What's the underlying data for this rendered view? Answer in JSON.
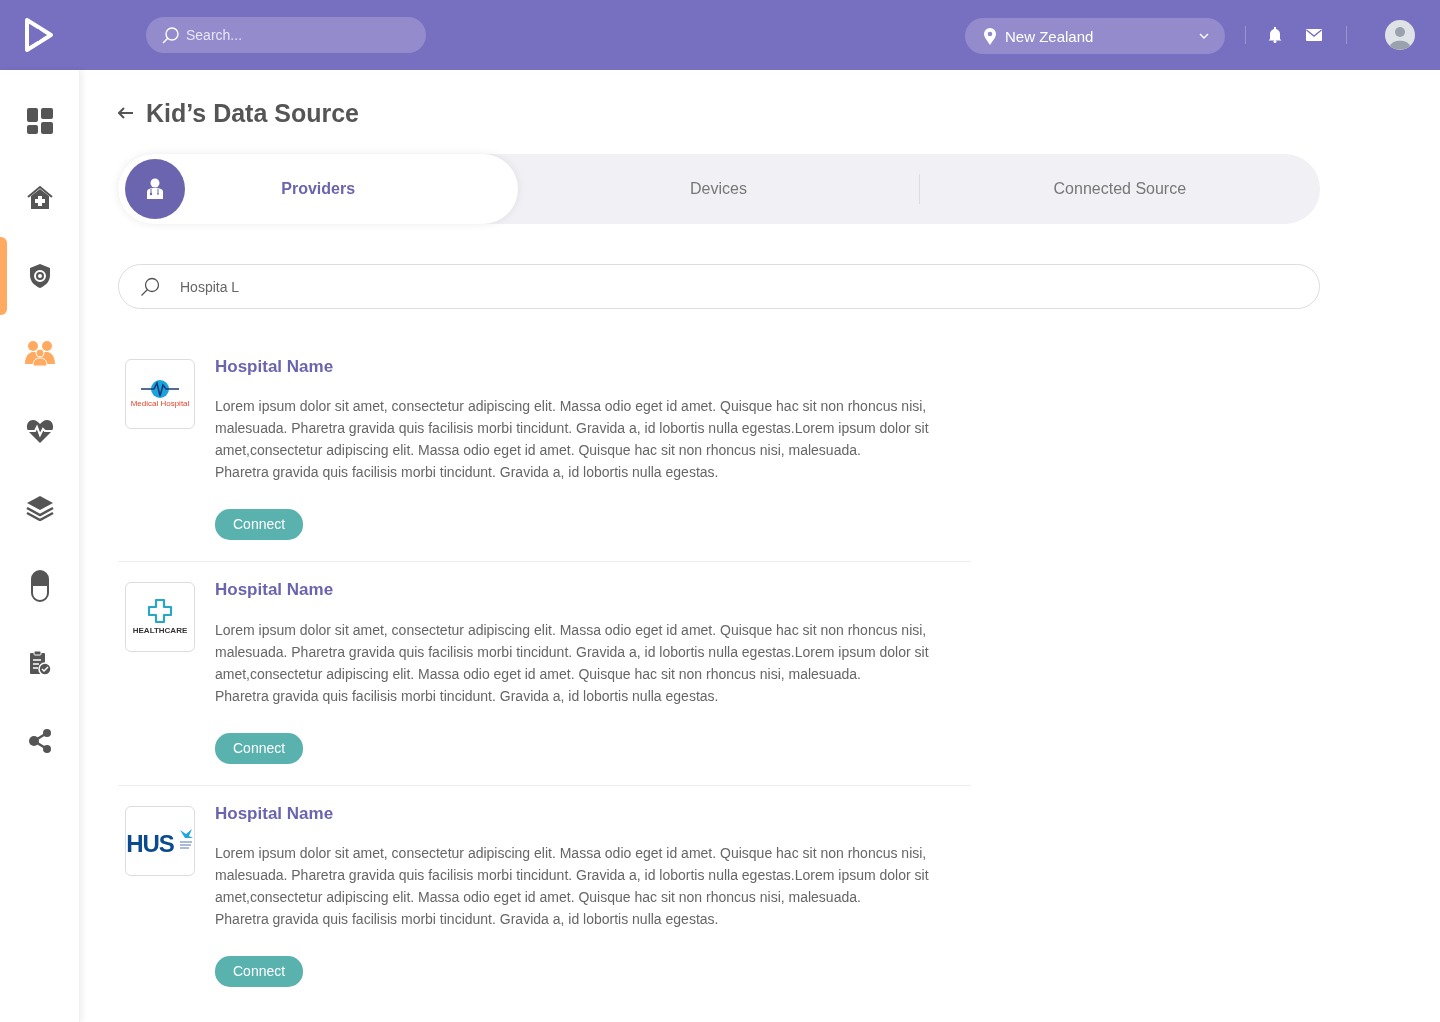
{
  "header": {
    "search": {
      "placeholder": "Search..."
    },
    "location": {
      "value": "New Zealand"
    }
  },
  "sidebar": {
    "items": [
      {
        "kind": "dashboard",
        "selected": false,
        "highlighted": false
      },
      {
        "kind": "clinic",
        "selected": false,
        "highlighted": false
      },
      {
        "kind": "shield",
        "selected": true,
        "highlighted": false
      },
      {
        "kind": "people",
        "selected": false,
        "highlighted": true
      },
      {
        "kind": "heart",
        "selected": false,
        "highlighted": false
      },
      {
        "kind": "layers",
        "selected": false,
        "highlighted": false
      },
      {
        "kind": "capsule",
        "selected": false,
        "highlighted": false
      },
      {
        "kind": "clipboard",
        "selected": false,
        "highlighted": false
      },
      {
        "kind": "share",
        "selected": false,
        "highlighted": false
      }
    ]
  },
  "page": {
    "title": "Kid’s Data Source"
  },
  "tabs": [
    {
      "label": "Providers",
      "selected": true
    },
    {
      "label": "Devices",
      "selected": false
    },
    {
      "label": "Connected Source",
      "selected": false
    }
  ],
  "search": {
    "value": "Hospita L"
  },
  "providers": [
    {
      "logo": {
        "kind": "medical",
        "text": "Medical Hospital"
      },
      "name": "Hospital Name",
      "description": "Lorem ipsum dolor sit amet, consectetur adipiscing elit. Massa odio eget id amet. Quisque hac sit non rhoncus nisi, malesuada. Pharetra gravida quis facilisis morbi tincidunt. Gravida a, id lobortis nulla egestas.Lorem ipsum dolor sit amet,consectetur adipiscing elit. Massa odio eget id amet. Quisque hac sit non rhoncus nisi, malesuada.\nPharetra gravida quis facilisis morbi tincidunt. Gravida a, id lobortis nulla egestas.",
      "button": "Connect"
    },
    {
      "logo": {
        "kind": "healthcare",
        "text": "HEALTHCARE"
      },
      "name": "Hospital Name",
      "description": "Lorem ipsum dolor sit amet, consectetur adipiscing elit. Massa odio eget id amet. Quisque hac sit non rhoncus nisi, malesuada. Pharetra gravida quis facilisis morbi tincidunt. Gravida a, id lobortis nulla egestas.Lorem ipsum dolor sit amet,consectetur adipiscing elit. Massa odio eget id amet. Quisque hac sit non rhoncus nisi, malesuada.\nPharetra gravida quis facilisis morbi tincidunt. Gravida a, id lobortis nulla egestas.",
      "button": "Connect"
    },
    {
      "logo": {
        "kind": "hus",
        "text": "HUS"
      },
      "name": "Hospital Name",
      "description": "Lorem ipsum dolor sit amet, consectetur adipiscing elit. Massa odio eget id amet. Quisque hac sit non rhoncus nisi, malesuada. Pharetra gravida quis facilisis morbi tincidunt. Gravida a, id lobortis nulla egestas.Lorem ipsum dolor sit amet,consectetur adipiscing elit. Massa odio eget id amet. Quisque hac sit non rhoncus nisi, malesuada.\nPharetra gravida quis facilisis morbi tincidunt. Gravida a, id lobortis nulla egestas.",
      "button": "Connect"
    }
  ]
}
